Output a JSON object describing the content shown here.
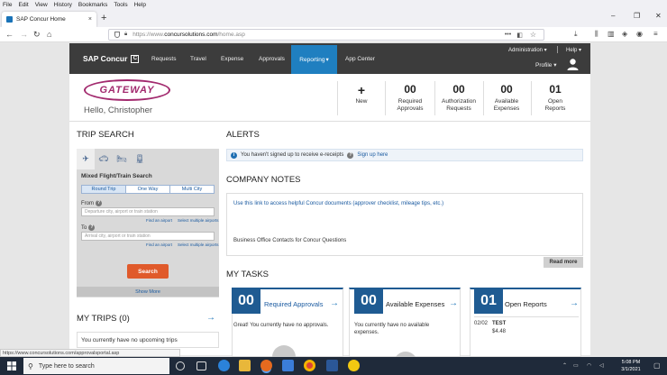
{
  "browser": {
    "menu": [
      "File",
      "Edit",
      "View",
      "History",
      "Bookmarks",
      "Tools",
      "Help"
    ],
    "tab_title": "SAP Concur Home",
    "tab_close": "×",
    "new_tab": "+",
    "window_controls": [
      "–",
      "❐",
      "✕"
    ],
    "url_prefix": "https://www.",
    "url_domain": "concursolutions.com",
    "url_path": "/home.asp",
    "url_dots": "•••",
    "status_url": "https://www.concursolutions.com/approvalsportal.asp"
  },
  "nav": {
    "brand": "SAP Concur",
    "brand_mark": "C",
    "items": [
      "Requests",
      "Travel",
      "Expense",
      "Approvals",
      "Reporting",
      "App Center"
    ],
    "reporting_caret": "▾",
    "administration": "Administration ▾",
    "help": "Help ▾",
    "profile": "Profile ▾"
  },
  "header": {
    "logo_text": "GATEWAY",
    "greeting": "Hello, Christopher",
    "new_plus": "+",
    "new_label": "New",
    "counters": [
      {
        "num": "00",
        "label1": "Required",
        "label2": "Approvals"
      },
      {
        "num": "00",
        "label1": "Authorization",
        "label2": "Requests"
      },
      {
        "num": "00",
        "label1": "Available",
        "label2": "Expenses"
      },
      {
        "num": "01",
        "label1": "Open",
        "label2": "Reports"
      }
    ]
  },
  "trip_search": {
    "title": "TRIP SEARCH",
    "subtitle": "Mixed Flight/Train Search",
    "toggles": [
      "Round Trip",
      "One Way",
      "Multi City"
    ],
    "from_label": "From",
    "from_placeholder": "Departure city, airport or train station",
    "to_label": "To",
    "to_placeholder": "Arrival city, airport or train station",
    "find_airport": "Find an airport",
    "select_airports": "Select multiple airports",
    "search_button": "Search",
    "show_more": "Show More"
  },
  "my_trips": {
    "title": "MY TRIPS (0)",
    "arrow": "→",
    "empty_text": "You currently have no upcoming trips"
  },
  "alerts": {
    "title": "ALERTS",
    "info_glyph": "i",
    "help_glyph": "?",
    "text": "You haven't signed up to receive e-receipts",
    "link": "Sign up here"
  },
  "company_notes": {
    "title": "COMPANY NOTES",
    "link": "Use this link to access helpful Concur documents (approver checklist, mileage tips, etc.)",
    "text": "Business Office Contacts for Concur Questions",
    "read_more": "Read more"
  },
  "tasks": {
    "title": "MY TASKS",
    "arrow": "→",
    "cards": [
      {
        "num": "00",
        "label": "Required Approvals",
        "text": "Great! You currently have no approvals."
      },
      {
        "num": "00",
        "label": "Available Expenses",
        "text": "You currently have no available expenses."
      },
      {
        "num": "01",
        "label": "Open Reports",
        "date": "02/02",
        "report_name": "TEST",
        "amount": "$4.48"
      }
    ]
  },
  "taskbar": {
    "search_placeholder": "Type here to search",
    "time": "5:08 PM",
    "date": "3/1/2021"
  },
  "colors": {
    "concur_blue": "#1f5b92",
    "reporting_blue": "#1f7fc0",
    "search_orange": "#e05a2b",
    "nav_dark": "#3c3c3c"
  }
}
